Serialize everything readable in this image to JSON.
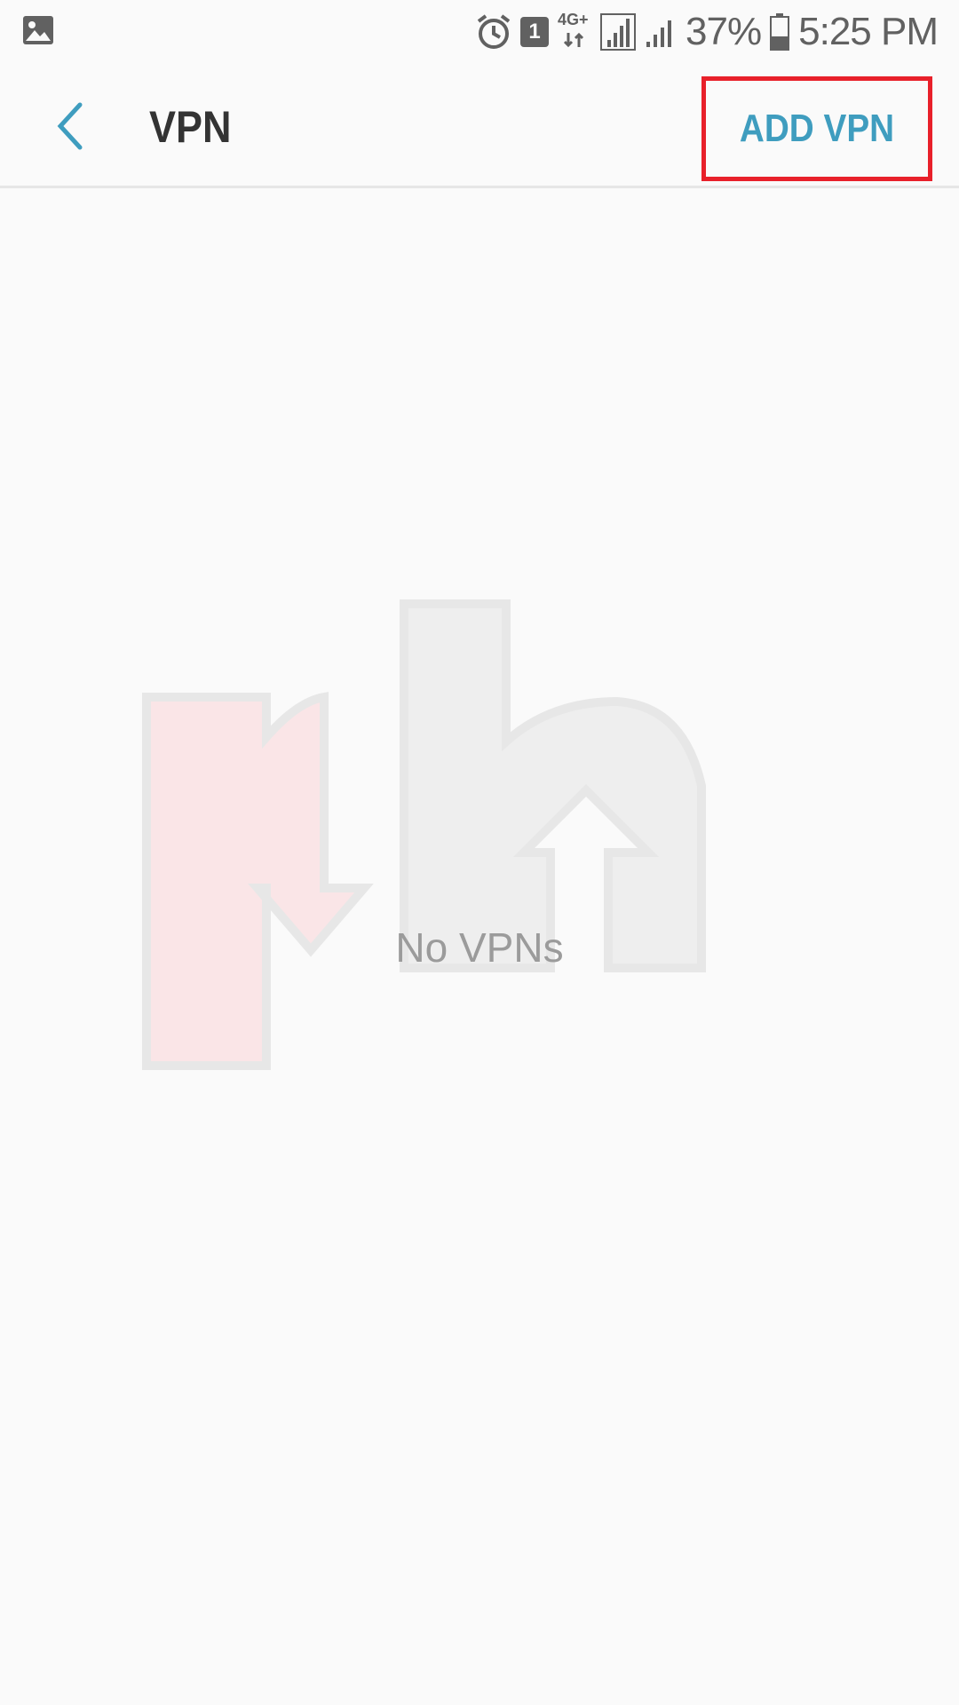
{
  "status_bar": {
    "battery_percent": "37%",
    "time": "5:25 PM",
    "sim_slot": "1",
    "network_type": "4G+"
  },
  "app_bar": {
    "title": "VPN",
    "action_label": "ADD VPN"
  },
  "content": {
    "empty_message": "No VPNs"
  },
  "colors": {
    "accent": "#3f9dbf",
    "highlight_box": "#e8202a",
    "title_text": "#333333",
    "background": "#fafafa"
  },
  "icons": {
    "status_left": "image-icon",
    "alarm": "alarm-icon",
    "signal": "signal-icon",
    "battery": "battery-icon",
    "back": "chevron-left-icon"
  }
}
